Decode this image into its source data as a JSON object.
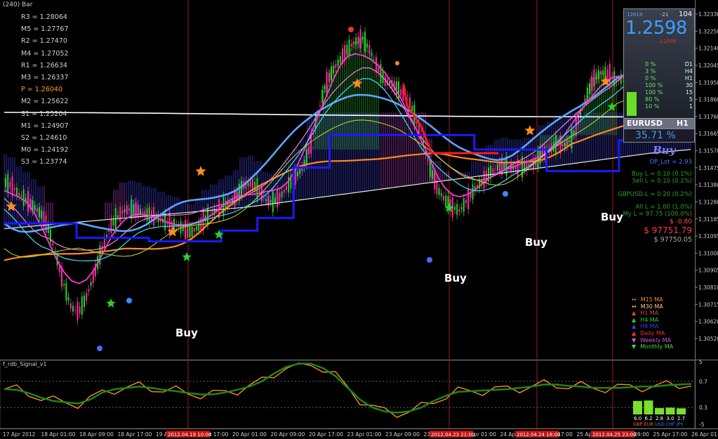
{
  "header": {
    "title": "(240) Bar"
  },
  "pivots": [
    {
      "label": "R3 = 1.28064",
      "color": "#cfcfcf"
    },
    {
      "label": "M5 = 1.27767",
      "color": "#cfcfcf"
    },
    {
      "label": "R2 = 1.27470",
      "color": "#cfcfcf"
    },
    {
      "label": "M4 = 1.27052",
      "color": "#cfcfcf"
    },
    {
      "label": "R1 = 1.26634",
      "color": "#cfcfcf"
    },
    {
      "label": "M3 = 1.26337",
      "color": "#cfcfcf"
    },
    {
      "label": "P = 1.26040",
      "color": "#ff9a2a"
    },
    {
      "label": "M2 = 1.25622",
      "color": "#cfcfcf"
    },
    {
      "label": "S1 = 1.25204",
      "color": "#cfcfcf"
    },
    {
      "label": "M1 = 1.24907",
      "color": "#cfcfcf"
    },
    {
      "label": "S2 = 1.24610",
      "color": "#cfcfcf"
    },
    {
      "label": "M0 = 1.24192",
      "color": "#cfcfcf"
    },
    {
      "label": "S3 = 1.23774",
      "color": "#cfcfcf"
    }
  ],
  "buy_labels": [
    "Buy",
    "Buy",
    "Buy",
    "Buy"
  ],
  "panel": {
    "spread_small": "12619",
    "change": "-21",
    "count": "104",
    "big_price": "1.2598",
    "price_pct": "1.2599",
    "tf_rows": [
      {
        "pct": "0 %",
        "tf": "D1"
      },
      {
        "pct": "3 %",
        "tf": "H4"
      },
      {
        "pct": "0 %",
        "tf": "H1"
      },
      {
        "pct": "100 %",
        "tf": "30"
      },
      {
        "pct": "100 %",
        "tf": "15"
      },
      {
        "pct": "80 %",
        "tf": "5"
      },
      {
        "pct": "10 %",
        "tf": "1"
      }
    ],
    "symbol": "EURUSD",
    "symbol_tf": "H1",
    "strength": "35.71 %",
    "signal": "Buy",
    "op_lot": "OP_Lot = 2.93",
    "buy_l": "Buy L = 0.10 (0.1%)",
    "sell_l": "Sell L = 0.10 (0.1%)",
    "gbp_l": "GBPUSD-L = 0.20 (0.2%)",
    "all_l": "All L = 1.00 (1.0%)",
    "my_l": "My L = 97.75 (100.0%)",
    "pnl": "$ -0.80",
    "equity": "$ 97751.79",
    "balance": "$ 97750.05"
  },
  "legend": [
    {
      "label": "M15 MA",
      "color": "#ff8a1e",
      "mark": "↔"
    },
    {
      "label": "M30 MA",
      "color": "#ffd28a",
      "mark": "↔"
    },
    {
      "label": "H1 MA",
      "color": "#e04040",
      "mark": "▲"
    },
    {
      "label": "H4 MA",
      "color": "#2ad02a",
      "mark": "▲"
    },
    {
      "label": "H8 MA",
      "color": "#3a3aff",
      "mark": "▲"
    },
    {
      "label": "Daily MA",
      "color": "#ff3030",
      "mark": "▲"
    },
    {
      "label": "Weekly MA",
      "color": "#e050e0",
      "mark": "▼"
    },
    {
      "label": "Monthly MA",
      "color": "#40e040",
      "mark": "▼"
    }
  ],
  "indicator": {
    "title": "f_rdb_Signal_v1",
    "levels": [
      "5",
      "0.7",
      "0.3",
      "-5"
    ],
    "bars": [
      {
        "value": "6.0",
        "cur": "GBP",
        "color": "#ff6a2a"
      },
      {
        "value": "6.2",
        "cur": "EUR",
        "color": "#ff6a2a"
      },
      {
        "value": "2.8",
        "cur": "USD",
        "color": "#3a7aff"
      },
      {
        "value": "3.0",
        "cur": "CHF",
        "color": "#3a7aff"
      },
      {
        "value": "2.7",
        "cur": "JPY",
        "color": "#3a7aff"
      }
    ]
  },
  "xaxis": {
    "ticks": [
      "17 Apr 2012",
      "18 Apr 01:00",
      "18 Apr 09:00",
      "18 Apr 17:00",
      "19 Apr 01:00",
      "19 Apr 17:00",
      "20 Apr 01:00",
      "20 Apr 09:00",
      "20 Apr 17:00",
      "23 Apr 01:00",
      "23 Apr 09:00",
      "23 Apr 17:00",
      "24 Apr 01:00",
      "24 Apr 09:00",
      "24 Apr 17:00",
      "25 Apr 01:00",
      "25 Apr 09:00",
      "25 Apr 17:00",
      "26 Apr 01:00"
    ],
    "highlights": [
      "2012.04.19 10:00",
      "2012.04.23 21:00",
      "2012.04.24 18:00",
      "2012.04.25 23:00"
    ]
  },
  "chart_data": {
    "type": "line",
    "yaxis_ticks": [
      "1.32330",
      "1.32250",
      "1.32140",
      "1.32045",
      "1.31950",
      "1.31860",
      "1.31760",
      "1.31665",
      "1.31570",
      "1.31475",
      "1.31380",
      "1.31280",
      "1.31185",
      "1.31095",
      "1.31000",
      "1.30905",
      "1.30810",
      "1.30715",
      "1.30620",
      "1.30520"
    ],
    "ylim": [
      1.3048,
      1.3236
    ],
    "price": [
      1.3142,
      1.314,
      1.3135,
      1.3132,
      1.3128,
      1.3124,
      1.3115,
      1.31,
      1.3085,
      1.3072,
      1.307,
      1.3078,
      1.309,
      1.3104,
      1.3115,
      1.3122,
      1.3126,
      1.3127,
      1.3126,
      1.3124,
      1.3123,
      1.3121,
      1.3119,
      1.3118,
      1.3116,
      1.3114,
      1.3117,
      1.3122,
      1.3125,
      1.3128,
      1.313,
      1.3133,
      1.314,
      1.3141,
      1.3138,
      1.3132,
      1.3131,
      1.3134,
      1.314,
      1.3145,
      1.315,
      1.3162,
      1.318,
      1.3196,
      1.3204,
      1.321,
      1.3216,
      1.322,
      1.3222,
      1.3215,
      1.3205,
      1.3198,
      1.3196,
      1.3192,
      1.319,
      1.3178,
      1.3165,
      1.315,
      1.3138,
      1.3132,
      1.3128,
      1.3126,
      1.3132,
      1.3138,
      1.3142,
      1.3147,
      1.315,
      1.3151,
      1.315,
      1.315,
      1.3151,
      1.3152,
      1.3158,
      1.316,
      1.3163,
      1.3162,
      1.3166,
      1.3178,
      1.319,
      1.32,
      1.3203,
      1.3202,
      1.3198,
      1.32,
      1.3201,
      1.32,
      1.3199,
      1.32,
      1.3206,
      1.3212,
      1.3218,
      1.3222,
      1.3224
    ],
    "indicator_line": [
      0.58,
      0.57,
      0.52,
      0.45,
      0.4,
      0.38,
      0.36,
      0.42,
      0.53,
      0.58,
      0.6,
      0.62,
      0.6,
      0.57,
      0.55,
      0.52,
      0.5,
      0.5,
      0.53,
      0.57,
      0.62,
      0.7,
      0.82,
      0.92,
      0.97,
      0.97,
      0.9,
      0.78,
      0.6,
      0.42,
      0.3,
      0.24,
      0.22,
      0.24,
      0.3,
      0.4,
      0.48,
      0.54,
      0.55,
      0.56,
      0.57,
      0.58,
      0.6,
      0.62,
      0.65,
      0.65,
      0.63,
      0.62,
      0.6,
      0.6,
      0.6,
      0.61,
      0.62,
      0.62,
      0.64,
      0.65,
      0.66
    ],
    "ma_curves": {
      "slow_white": [
        1.3116,
        1.3118,
        1.312,
        1.3122,
        1.3124,
        1.3126,
        1.3128,
        1.3131,
        1.3134,
        1.3137,
        1.314,
        1.3143,
        1.3146,
        1.3149,
        1.3152,
        1.3155,
        1.3158,
        1.316
      ],
      "blue_step": [
        1.3119,
        1.3119,
        1.3111,
        1.3111,
        1.3109,
        1.3109,
        1.3115,
        1.3122,
        1.315,
        1.3168,
        1.3168,
        1.3168,
        1.3168,
        1.316,
        1.316,
        1.3148,
        1.3148,
        1.3165,
        1.3165
      ]
    }
  }
}
